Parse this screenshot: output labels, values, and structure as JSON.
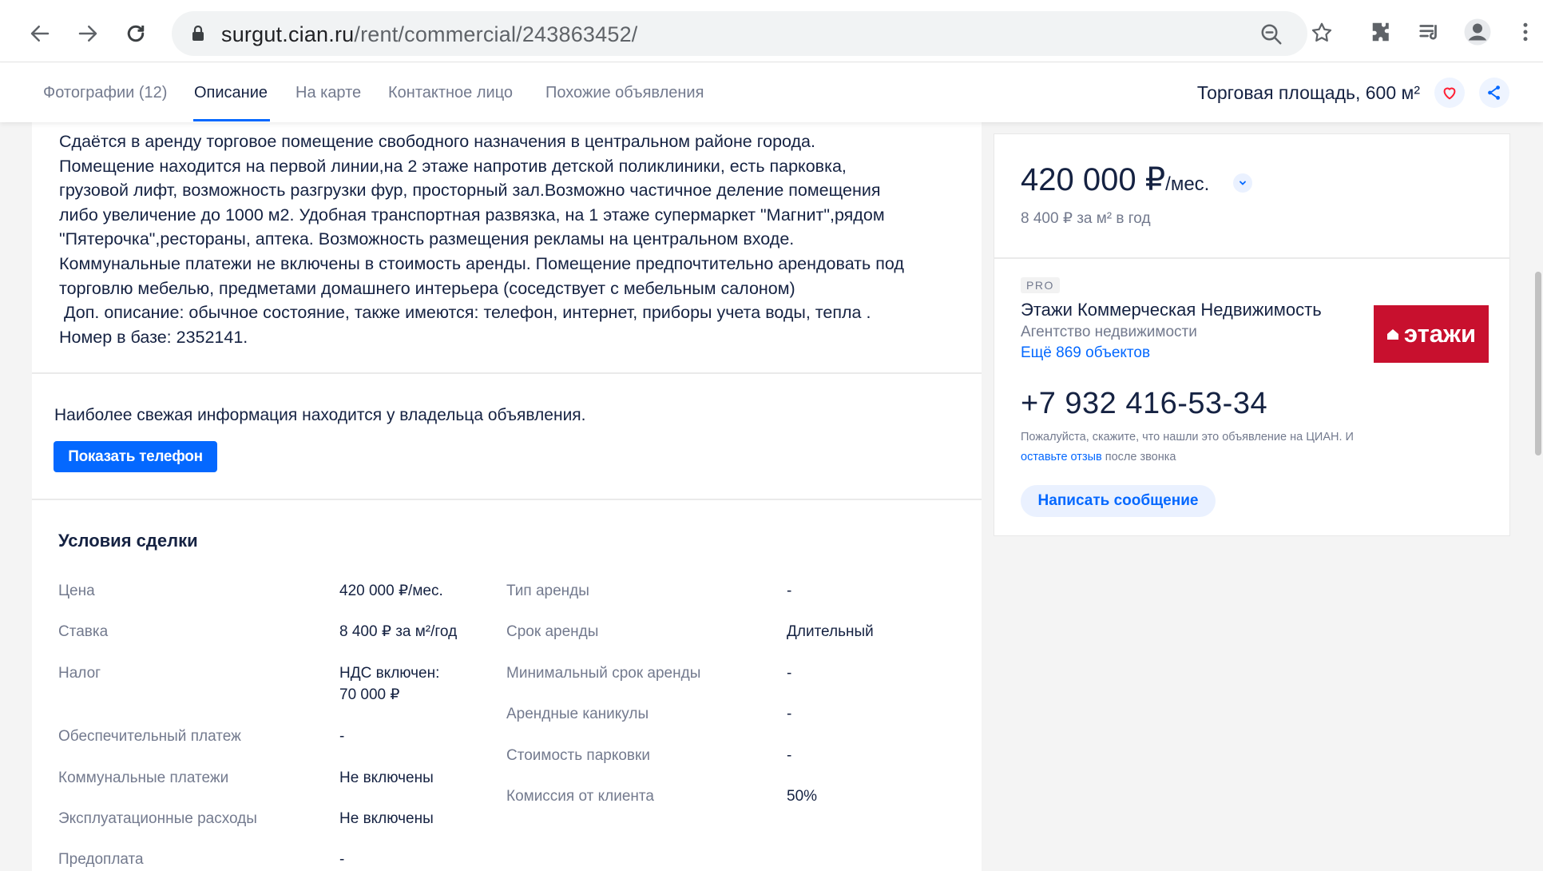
{
  "browser": {
    "url_host": "surgut.cian.ru",
    "url_path": "/rent/commercial/243863452/"
  },
  "tabs": [
    {
      "label": "Фотографии (12)"
    },
    {
      "label": "Описание"
    },
    {
      "label": "На карте"
    },
    {
      "label": "Контактное лицо"
    },
    {
      "label": "Похожие объявления"
    }
  ],
  "header_title": "Торговая площадь, 600 м²",
  "description": "Сдаётся в аренду торговое помещение свободного назначения в центральном районе города.\nПомещение находится на первой линии,на 2 этаже напротив детской поликлиники, есть парковка,\nгрузовой лифт, возможность разгрузки фур, просторный зал.Возможно частичное деление помещения\nлибо увеличение до 1000 м2. Удобная транспортная развязка, на 1 этаже супермаркет \"Магнит\",рядом\n\"Пятерочка\",рестораны, аптека. Возможность размещения рекламы на центральном входе.\nКоммунальные платежи не включены в стоимость аренды. Помещение предпочтительно арендовать под\nторговлю мебелью, предметами домашнего интерьера (соседствует с мебельным салоном)\n Доп. описание: обычное состояние, также имеются: телефон, интернет, приборы учета воды, тепла .\nНомер в базе: 2352141.",
  "owner_note": "Наиболее свежая информация находится у владельца объявления.",
  "show_phone_label": "Показать телефон",
  "deal": {
    "title": "Условия сделки",
    "left": [
      {
        "term": "Цена",
        "value": "420 000 ₽/мес."
      },
      {
        "term": "Ставка",
        "value": "8 400 ₽ за м²/год"
      },
      {
        "term": "Налог",
        "value": "НДС включен:\n70 000 ₽"
      },
      {
        "term": "Обеспечительный платеж",
        "value": "-"
      },
      {
        "term": "Коммунальные платежи",
        "value": "Не включены"
      },
      {
        "term": "Эксплуатационные расходы",
        "value": "Не включены"
      },
      {
        "term": "Предоплата",
        "value": "-"
      }
    ],
    "right": [
      {
        "term": "Тип аренды",
        "value": "-"
      },
      {
        "term": "Срок аренды",
        "value": "Длительный"
      },
      {
        "term": "Минимальный срок аренды",
        "value": "-"
      },
      {
        "term": "Арендные каникулы",
        "value": "-"
      },
      {
        "term": "Стоимость парковки",
        "value": "-"
      },
      {
        "term": "Комиссия от клиента",
        "value": "50%"
      }
    ]
  },
  "sidebar": {
    "price_main": "420 000 ₽",
    "price_unit": "/мес.",
    "price_sub": "8 400 ₽ за м² в год",
    "pro_label": "PRO",
    "agency_name": "Этажи Коммерческая Недвижимость",
    "agency_type": "Агентство недвижимости",
    "agency_more": "Ещё 869 объектов",
    "agency_logo_text": "этажи",
    "phone": "+7 932 416-53-34",
    "phone_note_1": "Пожалуйста, скажите, что нашли это объявление на ЦИАН. И ",
    "phone_note_link": "оставьте отзыв",
    "phone_note_2": " после звонка",
    "write_label": "Написать сообщение"
  },
  "colors": {
    "accent": "#0468ff",
    "logo_red": "#c8102e",
    "text_primary": "#152242",
    "text_secondary": "#737a8e"
  },
  "icons": [
    "back-arrow-icon",
    "forward-arrow-icon",
    "reload-icon",
    "lock-icon",
    "zoom-icon",
    "star-icon",
    "extension-icon",
    "media-icon",
    "profile-icon",
    "more-icon",
    "heart-icon",
    "share-icon",
    "chevron-down-icon"
  ]
}
